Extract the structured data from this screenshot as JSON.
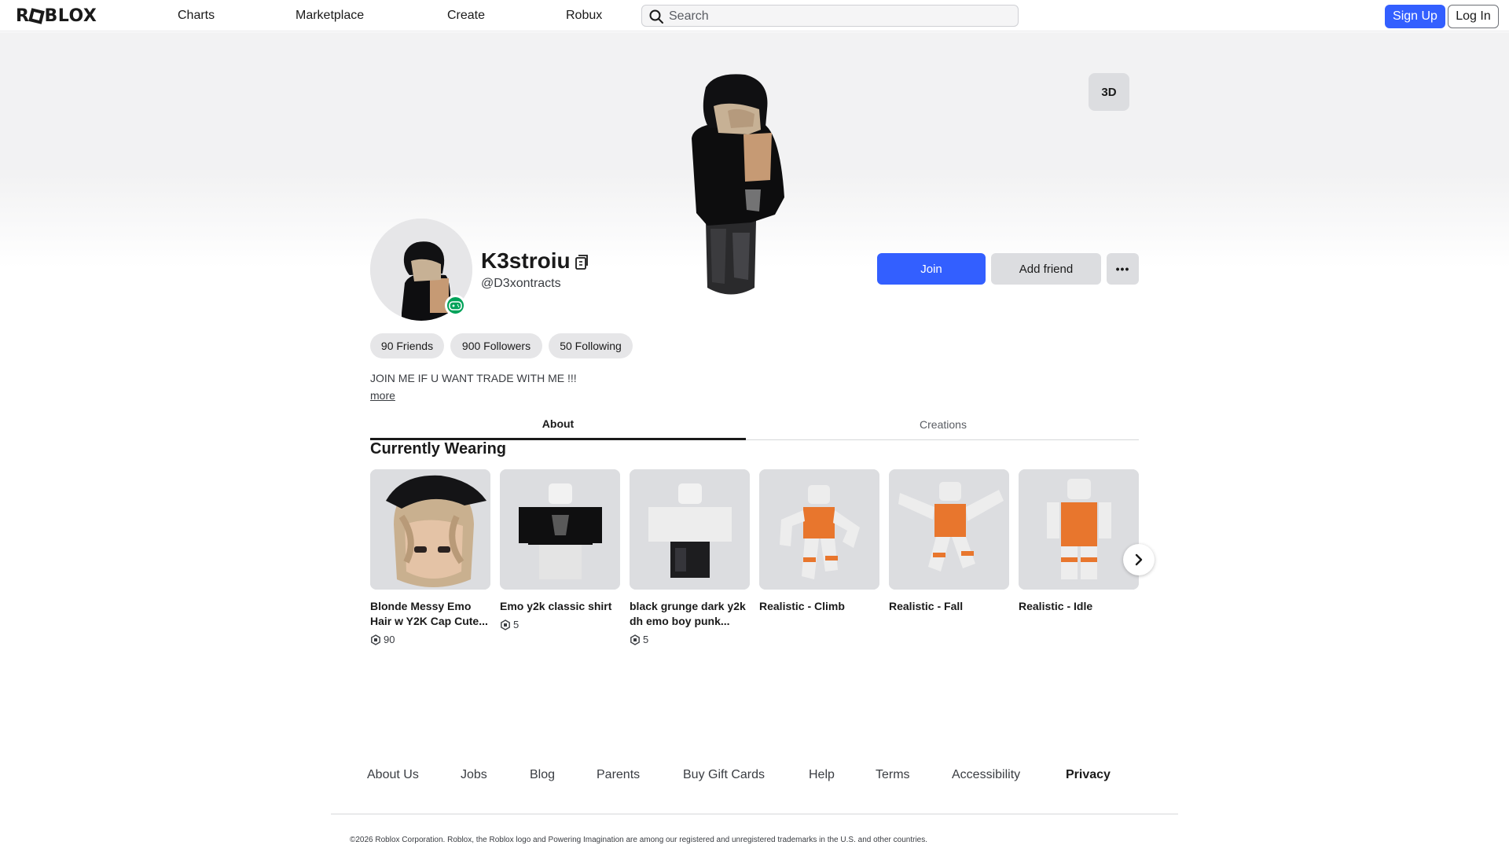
{
  "nav": {
    "logo_text": "ROBLOX",
    "links": [
      "Charts",
      "Marketplace",
      "Create",
      "Robux"
    ],
    "search_placeholder": "Search",
    "signup_label": "Sign Up",
    "login_label": "Log In"
  },
  "hero": {
    "view_toggle_label": "3D"
  },
  "profile": {
    "display_name": "K3stroiu",
    "username": "@D3xontracts",
    "join_label": "Join",
    "add_friend_label": "Add friend",
    "more_options_label": "•••",
    "stats": {
      "friends": "90 Friends",
      "followers": "900 Followers",
      "following": "50 Following"
    },
    "bio": "JOIN ME IF U WANT TRADE WITH ME !!!",
    "more_label": "more"
  },
  "tabs": {
    "about": "About",
    "creations": "Creations"
  },
  "wearing": {
    "title": "Currently Wearing",
    "items": [
      {
        "name": "Blonde Messy Emo Hair w Y2K Cap Cute...",
        "price": "90",
        "icon": "hair-accessory"
      },
      {
        "name": "Emo y2k classic shirt",
        "price": "5",
        "icon": "shirt"
      },
      {
        "name": "black grunge dark y2k dh emo boy punk...",
        "price": "5",
        "icon": "pants"
      },
      {
        "name": "Realistic - Climb",
        "price": null,
        "icon": "animation-climb"
      },
      {
        "name": "Realistic - Fall",
        "price": null,
        "icon": "animation-fall"
      },
      {
        "name": "Realistic - Idle",
        "price": null,
        "icon": "animation-idle"
      }
    ]
  },
  "footer": {
    "links": [
      "About Us",
      "Jobs",
      "Blog",
      "Parents",
      "Buy Gift Cards",
      "Help",
      "Terms",
      "Accessibility",
      "Privacy"
    ],
    "copyright": "©2026 Roblox Corporation. Roblox, the Roblox logo and Powering Imagination are among our registered and unregistered trademarks in the U.S. and other countries."
  },
  "colors": {
    "primary_blue": "#335fff",
    "online_green": "#00a259",
    "tile_gray": "#dcdde0",
    "animation_orange": "#e8762d"
  }
}
